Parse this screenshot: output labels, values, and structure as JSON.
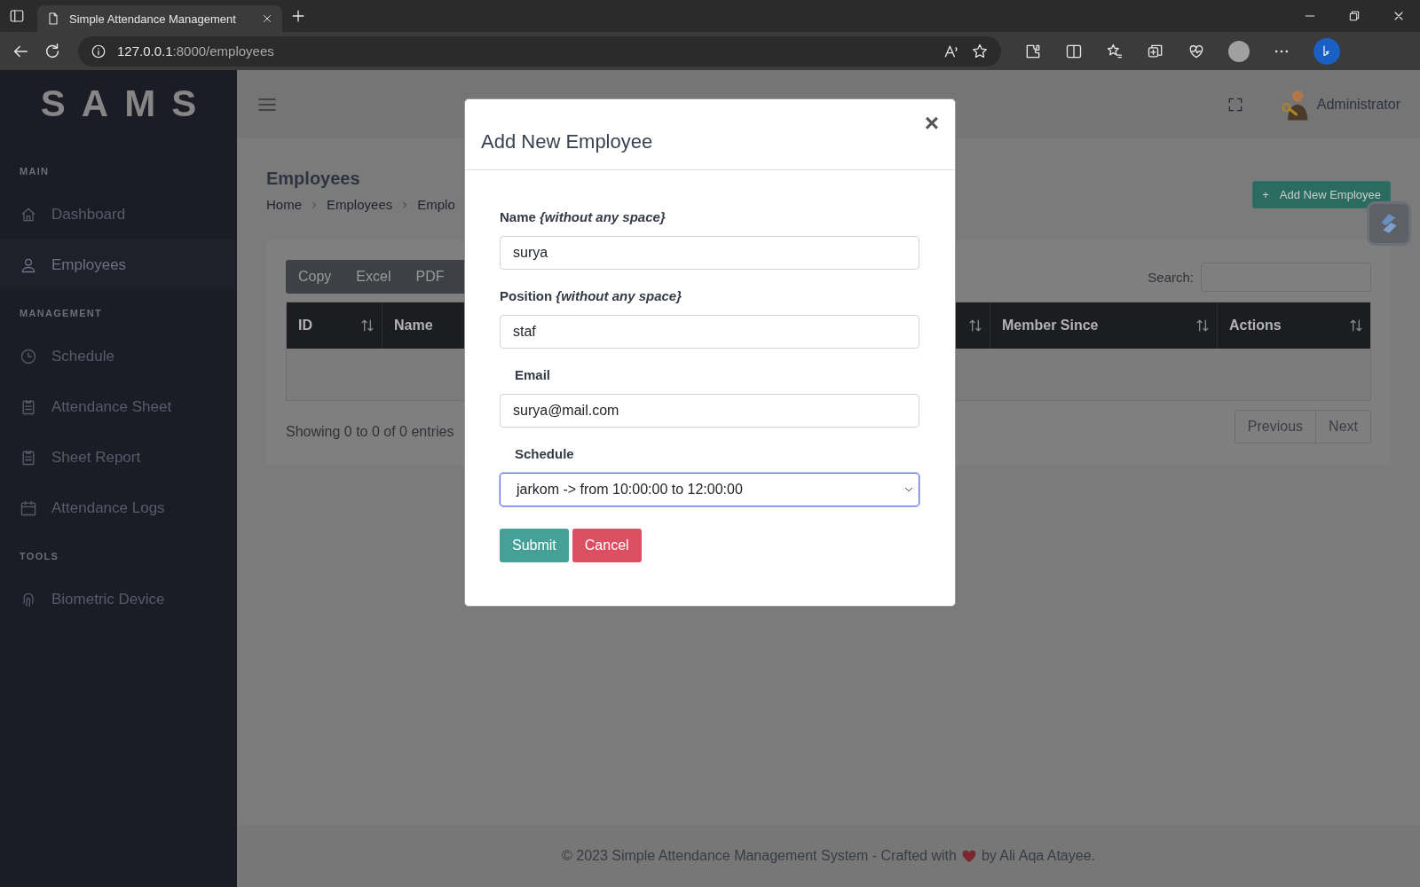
{
  "browser": {
    "tab_title": "Simple Attendance Management",
    "url_host": "127.0.0.1",
    "url_path": ":8000/employees"
  },
  "sidebar": {
    "logo": "SAMS",
    "sections": [
      {
        "heading": "MAIN",
        "items": [
          {
            "label": "Dashboard",
            "selected": false
          },
          {
            "label": "Employees",
            "selected": true
          }
        ]
      },
      {
        "heading": "MANAGEMENT",
        "items": [
          {
            "label": "Schedule",
            "selected": false
          },
          {
            "label": "Attendance Sheet",
            "selected": false
          },
          {
            "label": "Sheet Report",
            "selected": false
          },
          {
            "label": "Attendance Logs",
            "selected": false
          }
        ]
      },
      {
        "heading": "TOOLS",
        "items": [
          {
            "label": "Biometric Device",
            "selected": false
          }
        ]
      }
    ]
  },
  "header": {
    "user": "Administrator"
  },
  "page": {
    "title": "Employees",
    "breadcrumb": [
      "Home",
      "Employees",
      "Emplo"
    ],
    "add_button": {
      "icon": "+",
      "label": "Add New Employee"
    }
  },
  "table": {
    "export_buttons": [
      "Copy",
      "Excel",
      "PDF"
    ],
    "search_label": "Search:",
    "columns": [
      {
        "kind": "labeled",
        "label": "ID",
        "sort_icon": true
      },
      {
        "kind": "labeled",
        "label": "Name",
        "sort_icon": false
      },
      {
        "kind": "unlabeled",
        "sort_icon": true
      },
      {
        "kind": "labeled",
        "label": "Member Since",
        "sort_icon": true
      },
      {
        "kind": "labeled",
        "label": "Actions",
        "sort_icon": true
      }
    ],
    "info": "Showing 0 to 0 of 0 entries",
    "pagination": [
      "Previous",
      "Next"
    ]
  },
  "modal": {
    "title": "Add New Employee",
    "close": "×",
    "fields": [
      {
        "kind": "text",
        "label": "Name *{without any space}*",
        "value": "surya",
        "indented": false,
        "focused": false
      },
      {
        "kind": "text",
        "label": "Position *{without any space}*",
        "value": "staf",
        "indented": false,
        "focused": false
      },
      {
        "kind": "text",
        "label": "Email",
        "value": "surya@mail.com",
        "indented": true,
        "focused": false
      },
      {
        "kind": "select",
        "label": "Schedule",
        "value": "jarkom -> from 10:00:00 to 12:00:00",
        "indented": true,
        "focused": true
      }
    ],
    "buttons": [
      {
        "kind": "primary",
        "label": "Submit"
      },
      {
        "kind": "danger",
        "label": "Cancel"
      }
    ]
  },
  "footer": {
    "text_before": "© 2023 Simple Attendance Management System - Crafted with",
    "text_after": "by Ali Aqa Atayee."
  }
}
